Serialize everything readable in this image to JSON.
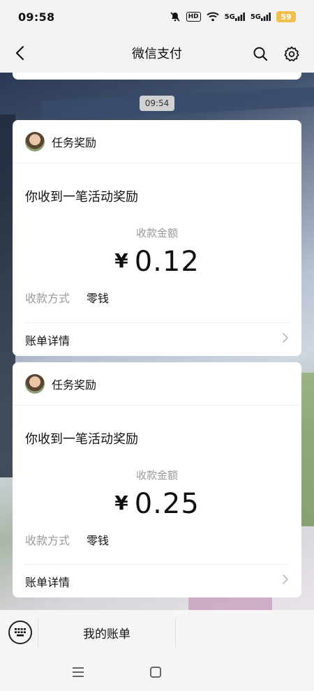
{
  "status_bar": {
    "time": "09:58",
    "hd": "HD",
    "signal1": "5G",
    "signal2": "5G",
    "battery": "59",
    "battery_color": "#f0c04a"
  },
  "nav": {
    "title": "微信支付",
    "back_icon": "chevron-left-icon",
    "search_icon": "search-icon",
    "settings_icon": "gear-icon"
  },
  "timestamp": "09:54",
  "cards": [
    {
      "from": "任务奖励",
      "subject": "你收到一笔活动奖励",
      "amount_label": "收款金额",
      "currency": "¥",
      "amount": "0.12",
      "method_label": "收款方式",
      "method_value": "零钱",
      "footer_label": "账单详情"
    },
    {
      "from": "任务奖励",
      "subject": "你收到一笔活动奖励",
      "amount_label": "收款金额",
      "currency": "¥",
      "amount": "0.25",
      "method_label": "收款方式",
      "method_value": "零钱",
      "footer_label": "账单详情"
    }
  ],
  "bottom_bar": {
    "menu_item": "我的账单",
    "keyboard_icon": "keyboard-icon"
  }
}
